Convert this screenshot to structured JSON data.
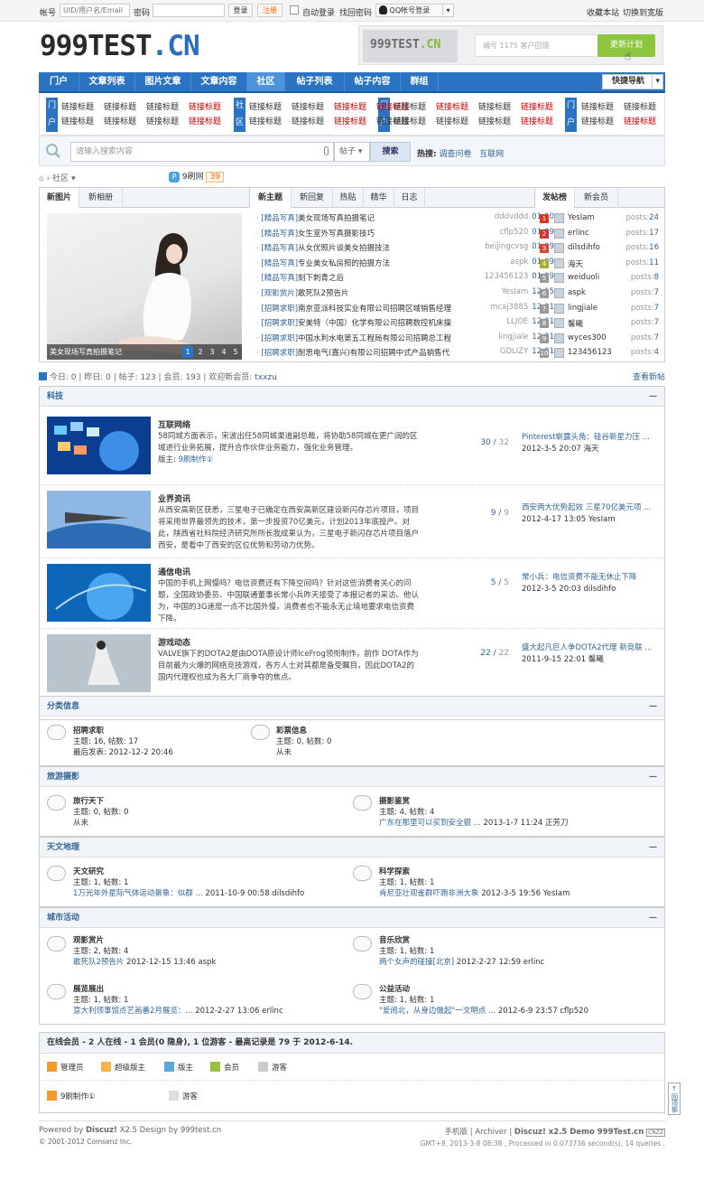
{
  "topbar": {
    "account_label": "帐号",
    "account_placeholder": "UID/用户名/Email",
    "password_label": "密码",
    "login": "登录",
    "register": "注册",
    "auto_login": "自动登录",
    "find_password": "找回密码",
    "qq_login": "QQ帐号登录",
    "favorite": "收藏本站",
    "wide": "切换到宽版"
  },
  "logo": {
    "main": "999TEST",
    "suffix": ".CN"
  },
  "banner": {
    "logo_main": "999TEST",
    "logo_suffix": ".CN",
    "input_placeholder": "编号 1175  客户回馈",
    "button": "更新计划"
  },
  "nav": {
    "items": [
      "门户",
      "文章列表",
      "图片文章",
      "文章内容",
      "社区",
      "帖子列表",
      "帖子内容",
      "群组"
    ],
    "active": 4,
    "quick": "快捷导航"
  },
  "subnav": {
    "tags": [
      "门户",
      "社区",
      "门户",
      "门户"
    ],
    "link": "链接标题"
  },
  "search": {
    "placeholder": "请输入搜索内容",
    "type": "帖子",
    "button": "搜索",
    "hot_label": "热搜:",
    "hot": [
      "调查问卷",
      "互联网"
    ]
  },
  "crumb": {
    "home": "社区",
    "site": "9刷网",
    "count": "39"
  },
  "portal": {
    "left_tabs": [
      "新图片",
      "新相册"
    ],
    "mid_tabs": [
      "新主题",
      "新回复",
      "热贴",
      "精华",
      "日志"
    ],
    "right_tabs": [
      "发帖榜",
      "新会员"
    ],
    "photo_caption": "美女现场写真拍摄笔记",
    "pages": [
      "1",
      "2",
      "3",
      "4",
      "5"
    ],
    "threads": [
      {
        "cat": "[精品写真]",
        "title": "美女现场写真拍摄笔记",
        "user": "dddvddd",
        "date": "01-10"
      },
      {
        "cat": "[精品写真]",
        "title": "女生室外写真摄影技巧",
        "user": "cflp520",
        "date": "01-09"
      },
      {
        "cat": "[精品写真]",
        "title": "从女优照片谈美女拍摄技法",
        "user": "beijingcvsg",
        "date": "01-09"
      },
      {
        "cat": "[精品写真]",
        "title": "专业美女私房照的拍摄方法",
        "user": "aspk",
        "date": "01-09"
      },
      {
        "cat": "[精品写真]",
        "title": "刻下刺青之后",
        "user": "123456123",
        "date": "01-09"
      },
      {
        "cat": "[观影赏片]",
        "title": "敢死队2预告片",
        "user": "YesIam",
        "date": "12-15"
      },
      {
        "cat": "[招聘求职]",
        "title": "南京亚派科技实业有限公司招聘区域销售经理",
        "user": "mcaj3885",
        "date": "12-01"
      },
      {
        "cat": "[招聘求职]",
        "title": "安美特（中国）化学有限公司招聘数控机床操",
        "user": "LLJOE",
        "date": "12-01"
      },
      {
        "cat": "[招聘求职]",
        "title": "中国水利水电第五工程局有限公司招聘总工程",
        "user": "lingjiale",
        "date": "12-01"
      },
      {
        "cat": "[招聘求职]",
        "title": "耐思电气(嘉兴)有限公司招聘中式产品销售代",
        "user": "GDLIZY",
        "date": "12-01"
      }
    ],
    "ranks": [
      {
        "n": "1",
        "name": "YesIam",
        "posts": "24"
      },
      {
        "n": "2",
        "name": "erlinc",
        "posts": "17"
      },
      {
        "n": "3",
        "name": "dilsdihfo",
        "posts": "16"
      },
      {
        "n": "4",
        "name": "海天",
        "posts": "11"
      },
      {
        "n": "5",
        "name": "weiduoli",
        "posts": "8"
      },
      {
        "n": "6",
        "name": "aspk",
        "posts": "7"
      },
      {
        "n": "7",
        "name": "lingjiale",
        "posts": "7"
      },
      {
        "n": "8",
        "name": "馨曦",
        "posts": "7"
      },
      {
        "n": "9",
        "name": "wyces300",
        "posts": "7"
      },
      {
        "n": "10",
        "name": "123456123",
        "posts": "4"
      }
    ],
    "posts_label": "posts:"
  },
  "stats": {
    "text": "今日: 0 | 昨日: 0 | 帖子: 123 | 会员: 193 | 欢迎新会员: ",
    "new_member": "txxzu",
    "view_new": "查看新帖"
  },
  "sections": {
    "keji": {
      "title": "科技",
      "forums": [
        {
          "name": "互联网络",
          "desc": "58同城方面表示，宋波出任58同城渠道副总裁，将协助58同城在更广阔的区域进行业务拓展，提升合作伙伴业务能力，强化业务管理。",
          "mod": "版主: ",
          "mod_name": "9刷制作①",
          "count_a": "30",
          "count_b": "32",
          "last_title": "Pinterest崭露头角：硅谷新星力压 ...",
          "last_meta": "2012-3-5 20:07 海天"
        },
        {
          "name": "业界资讯",
          "desc": "从西安高新区获悉，三星电子已确定在西安高新区建设新闪存芯片项目，项目将采用世界最领先的技术，第一步投资70亿美元，计划2013年底投产。对此，陕西省社科院经济研究所所长我成果认为，三星电子新闪存芯片项目落户西安，是看中了西安的区位优势和劳动力优势。",
          "mod": "",
          "mod_name": "",
          "count_a": "9",
          "count_b": "9",
          "last_title": "西安两大优势起效 三星70亿美元项 ...",
          "last_meta": "2012-4-17 13:05 YesIam"
        },
        {
          "name": "通信电讯",
          "desc": "中国的手机上网慢吗？电信资费还有下降空间吗？针对这些消费者关心的问题，全国政协委员、中国联通董事长常小兵昨天接受了本报记者的采访。他认为，中国的3G速度一点不比国外慢，消费者也不能永无止境地要求电信资费下降。",
          "mod": "",
          "mod_name": "",
          "count_a": "5",
          "count_b": "5",
          "last_title": "常小兵：电信资费不能无休止下降",
          "last_meta": "2012-3-5 20:03 dilsdihfo"
        },
        {
          "name": "游戏动态",
          "desc": "VALVE旗下的DOTA2是由DOTA原设计师IceFrog领衔制作，前作 DOTA作为目前最为火爆的网络竞技游戏，各方人士对其都是备受瞩目，因此DOTA2的国内代理权也成为各大厂商争夺的焦点。",
          "mod": "",
          "mod_name": "",
          "count_a": "22",
          "count_b": "22",
          "last_title": "盛大起凡巨人争DOTA2代理 新竞联 ...",
          "last_meta": "2011-9-15 22:01 馨曦"
        }
      ]
    },
    "fenlei": {
      "title": "分类信息",
      "forums": [
        {
          "name": "招聘求职",
          "l1": "主题: 16, 帖数: 17",
          "l2": "最后发表: 2012-12-2 20:46"
        },
        {
          "name": "彩票信息",
          "l1": "主题: 0, 帖数: 0",
          "l2": "从未"
        }
      ]
    },
    "lvyou": {
      "title": "旅游摄影",
      "forums": [
        {
          "name": "旅行天下",
          "l1": "主题: 0, 帖数: 0",
          "l2": "从未",
          "l2link": ""
        },
        {
          "name": "摄影鉴赏",
          "l1": "主题: 4, 帖数: 4",
          "l2link": "广东在那里可以买到安全银 ...",
          "l2": " 2013-1-7 11:24 正芳刀"
        }
      ]
    },
    "tianwen": {
      "title": "天文地理",
      "forums": [
        {
          "name": "天文研究",
          "l1": "主题: 1, 帖数: 1",
          "l2link": "1万光年外星际气体运动景象：似群 ...",
          "l2": " 2011-10-9 00:58 dilsdihfo"
        },
        {
          "name": "科学探索",
          "l1": "主题: 1, 帖数: 1",
          "l2link": "肯尼亚壮观雀群吓跑非洲大象",
          "l2": " 2012-3-5 19:56 YesIam"
        }
      ]
    },
    "chengshi": {
      "title": "城市活动",
      "forums": [
        {
          "name": "观影赏片",
          "l1": "主题: 2, 帖数: 4",
          "l2link": "敢死队2预告片",
          "l2": " 2012-12-15 13:46 aspk"
        },
        {
          "name": "音乐欣赏",
          "l1": "主题: 1, 帖数: 1",
          "l2link": "两个女声的碰撞[北京]",
          "l2": " 2012-2-27 12:59 erlinc"
        },
        {
          "name": "展览展出",
          "l1": "主题: 1, 帖数: 1",
          "l2link": "意大利领事馆点艺画番2月展览：...",
          "l2": " 2012-2-27 13:06 erlinc"
        },
        {
          "name": "公益活动",
          "l1": "主题: 1, 帖数: 1",
          "l2link": "\"爱闹北，从身边做起\"一文明点 ...",
          "l2": " 2012-6-9 23:57 cflp520"
        }
      ]
    }
  },
  "online": {
    "title": "在线会员 - 2 人在线 - 1 会员(0 隐身), 1 位游客 - 最高记录是 79 于 2012-6-14.",
    "legend": [
      "管理员",
      "超级版主",
      "版主",
      "会员",
      "游客"
    ],
    "legend_colors": [
      "#f39a2d",
      "#f6b44b",
      "#56a7e0",
      "#9bc23a",
      "#cccccc"
    ],
    "users": [
      "9刷制作①",
      "游客"
    ]
  },
  "footer": {
    "powered": "Powered by ",
    "discuz": "Discuz!",
    "version": " X2.5 Design by 999test.cn",
    "copyright": "© 2001-2012 Comsenz Inc.",
    "links": "手机版 | Archiver | ",
    "demo": "Discuz! x2.5 Demo 999Test.cn",
    "cnzz": "CNZZ",
    "gmt": "GMT+8, 2013-3-8 08:38 , Processed in 0.073736 second(s), 14 queries ."
  },
  "totop": "回顶部"
}
